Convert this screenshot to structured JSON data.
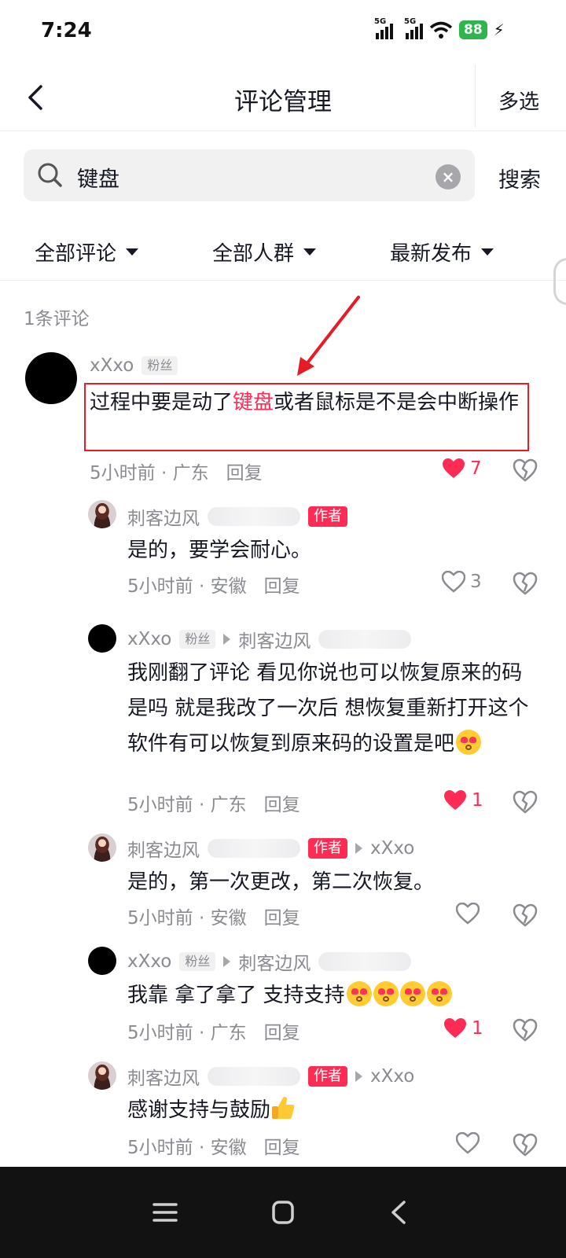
{
  "status": {
    "time": "7:24",
    "net1": "5G",
    "net2": "5G",
    "battery": "88"
  },
  "nav": {
    "title": "评论管理",
    "multi_select": "多选"
  },
  "search": {
    "value": "键盘",
    "button": "搜索"
  },
  "filters": [
    "全部评论",
    "全部人群",
    "最新发布"
  ],
  "count_label": "1条评论",
  "colors": {
    "accent": "#fe2c55",
    "annotation": "#e51c23"
  },
  "comment": {
    "user": "xXxo",
    "tag": "粉丝",
    "text_before": "过程中要是动了",
    "text_highlight": "键盘",
    "text_after": "或者鼠标是不是会中断操作",
    "time": "5小时前",
    "location": "广东",
    "reply": "回复",
    "likes": "7"
  },
  "replies": [
    {
      "user": "刺客边风",
      "author_tag": "作者",
      "text": "是的，要学会耐心。",
      "time": "5小时前",
      "location": "安徽",
      "reply": "回复",
      "likes": "3"
    },
    {
      "user": "xXxo",
      "tag": "粉丝",
      "reply_to": "刺客边风",
      "text": "我刚翻了评论  看见你说也可以恢复原来的码是吗  就是我改了一次后  想恢复重新打开这个软件有可以恢复到原来码的设置是吧",
      "time": "5小时前",
      "location": "广东",
      "reply": "回复",
      "likes": "1"
    },
    {
      "user": "刺客边风",
      "author_tag": "作者",
      "reply_to": "xXxo",
      "text": "是的，第一次更改，第二次恢复。",
      "time": "5小时前",
      "location": "安徽",
      "reply": "回复",
      "likes": ""
    },
    {
      "user": "xXxo",
      "tag": "粉丝",
      "reply_to": "刺客边风",
      "text": "我靠  拿了拿了  支持支持",
      "time": "5小时前",
      "location": "广东",
      "reply": "回复",
      "likes": "1"
    },
    {
      "user": "刺客边风",
      "author_tag": "作者",
      "reply_to": "xXxo",
      "text": "感谢支持与鼓励",
      "time": "5小时前",
      "location": "安徽",
      "reply": "回复",
      "likes": ""
    }
  ]
}
